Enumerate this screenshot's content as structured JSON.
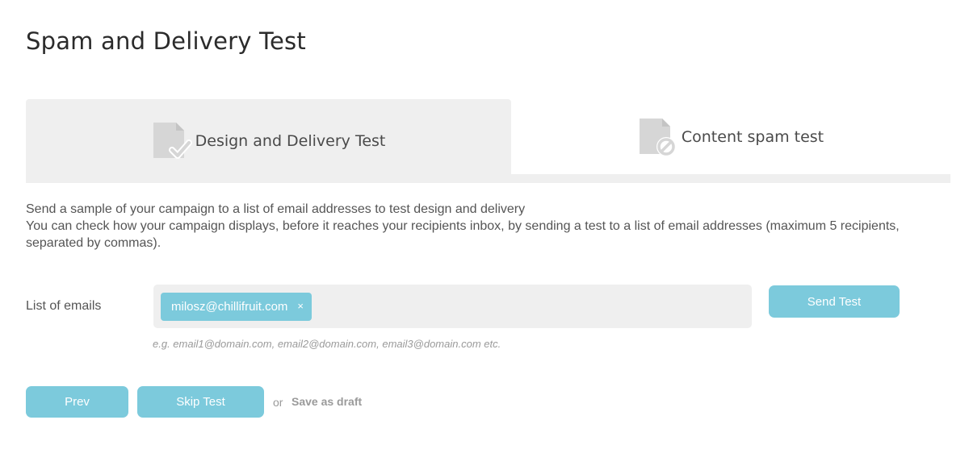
{
  "page": {
    "title": "Spam and Delivery Test"
  },
  "tabs": [
    {
      "label": "Design and Delivery Test",
      "icon": "document-check-icon",
      "active": true
    },
    {
      "label": "Content spam test",
      "icon": "document-blocked-icon",
      "active": false
    }
  ],
  "description": {
    "line1": "Send a sample of your campaign to a list of email addresses to test design and delivery",
    "line2": "You can check how your campaign displays, before it reaches your recipients inbox, by sending a test to a list of email addresses (maximum 5 recipients, separated by commas)."
  },
  "emails": {
    "label": "List of emails",
    "chips": [
      {
        "value": "milosz@chillifruit.com",
        "remove": "×"
      }
    ],
    "hint": "e.g. email1@domain.com, email2@domain.com, email3@domain.com etc."
  },
  "buttons": {
    "send_test": "Send Test",
    "prev": "Prev",
    "skip_test": "Skip Test",
    "or": "or",
    "save_draft": "Save as draft"
  },
  "colors": {
    "accent": "#7ccadc",
    "tab_background": "#efefef",
    "title_text": "#2b2b2b",
    "muted_text": "#9a9a9a"
  }
}
